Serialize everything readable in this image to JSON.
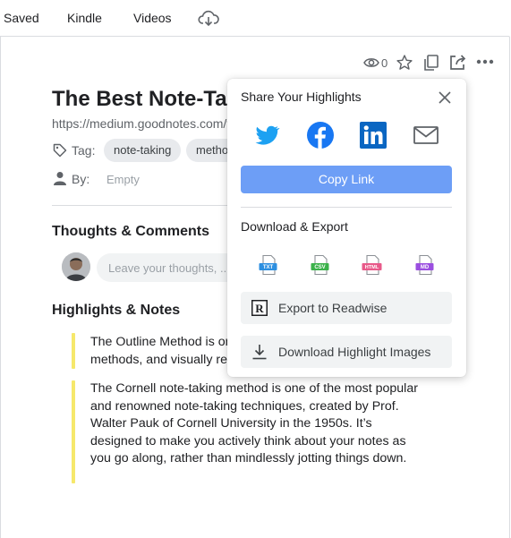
{
  "nav": {
    "saved": "Saved",
    "kindle": "Kindle",
    "videos": "Videos"
  },
  "toolbar": {
    "view_count": "0"
  },
  "article": {
    "title": "The Best Note-Taking Methods",
    "url": "https://medium.goodnotes.com/the-best-note-taking-methods",
    "tag_label": "Tag:",
    "tags": [
      "note-taking",
      "methods"
    ],
    "by_label": "By:",
    "by_value": "Empty"
  },
  "comments": {
    "heading": "Thoughts & Comments",
    "placeholder": "Leave your thoughts, ..."
  },
  "highlights": {
    "heading": "Highlights & Notes",
    "items": [
      {
        "text": "The Outline Method is one of the most popular note-taking methods, and visually represents ideas."
      },
      {
        "text": "The Cornell note-taking method is one of the most popular and renowned note-taking techniques, created by Prof. Walter Pauk of Cornell University in the 1950s. It’s designed to make you actively think about your notes as you go along, rather than mindlessly jotting things down."
      }
    ]
  },
  "share_popup": {
    "title": "Share Your Highlights",
    "share_targets": [
      "twitter-icon",
      "facebook-icon",
      "linkedin-icon",
      "email-icon"
    ],
    "copy_link": "Copy Link",
    "download_heading": "Download & Export",
    "formats": [
      {
        "label": "TXT",
        "color": "#2d8fe0"
      },
      {
        "label": "CSV",
        "color": "#3bb14a"
      },
      {
        "label": "HTML",
        "color": "#e85a8a"
      },
      {
        "label": "MD",
        "color": "#9b4fe0"
      }
    ],
    "export_readwise": "Export to Readwise",
    "download_images": "Download Highlight Images"
  },
  "colors": {
    "accent": "#6d9ef6",
    "highlight_bar": "#f6e86b",
    "twitter": "#1da1f2",
    "facebook": "#1877f2",
    "linkedin": "#0a66c2"
  }
}
